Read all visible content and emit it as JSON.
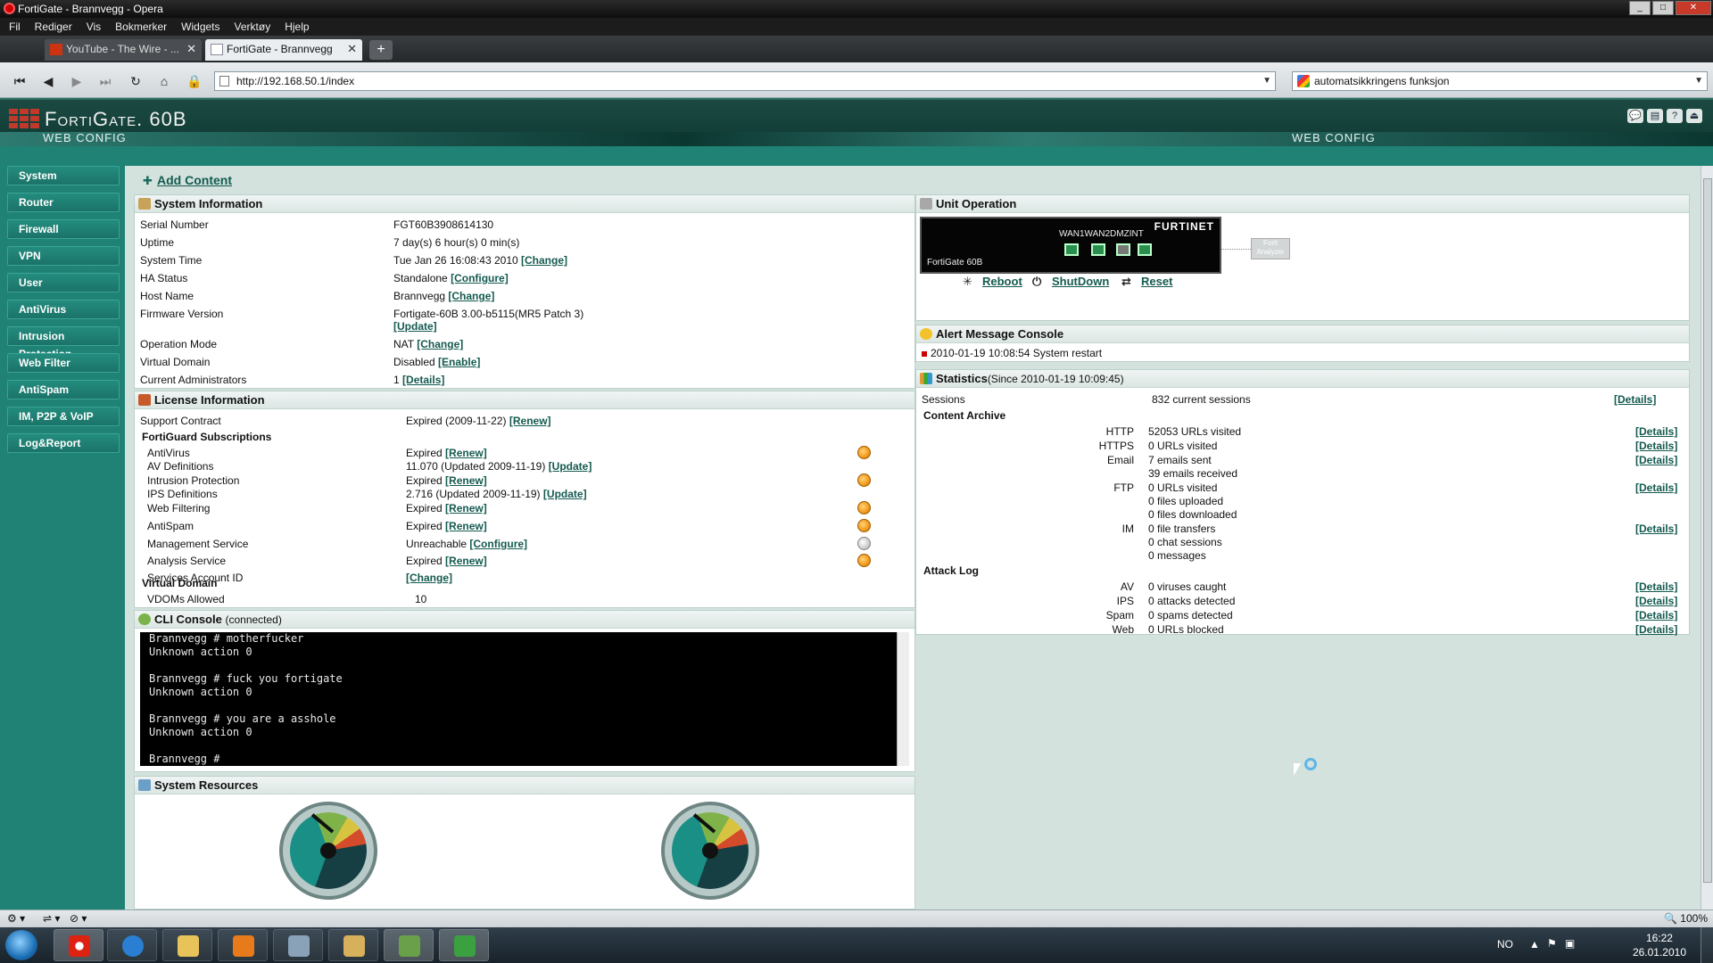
{
  "window": {
    "title": "FortiGate - Brannvegg - Opera"
  },
  "menu": [
    "Fil",
    "Rediger",
    "Vis",
    "Bokmerker",
    "Widgets",
    "Verktøy",
    "Hjelp"
  ],
  "tabs": [
    {
      "label": "YouTube - The Wire - ..."
    },
    {
      "label": "FortiGate - Brannvegg"
    }
  ],
  "nav": {
    "address": "http://192.168.50.1/index",
    "search": "automatsikkringens funksjon"
  },
  "fortigate": {
    "product": "FortiGate",
    "model": "60B",
    "webconfig": "WEB CONFIG"
  },
  "sidebar": [
    "System",
    "Router",
    "Firewall",
    "VPN",
    "User",
    "AntiVirus",
    "Intrusion Protection",
    "Web Filter",
    "AntiSpam",
    "IM, P2P & VoIP",
    "Log&Report"
  ],
  "add_content": "Add Content",
  "sysinfo": {
    "title": "System Information",
    "rows": [
      {
        "label": "Serial Number",
        "value": "FGT60B3908614130",
        "link": ""
      },
      {
        "label": "Uptime",
        "value": "7 day(s) 6 hour(s) 0 min(s)",
        "link": ""
      },
      {
        "label": "System Time",
        "value": "Tue Jan 26 16:08:43 2010",
        "link": "[Change]"
      },
      {
        "label": "HA Status",
        "value": "Standalone",
        "link": "[Configure]"
      },
      {
        "label": "Host Name",
        "value": "Brannvegg",
        "link": "[Change]"
      },
      {
        "label": "Firmware Version",
        "value": "Fortigate-60B 3.00-b5115(MR5 Patch 3)",
        "link": "[Update]"
      },
      {
        "label": "Operation Mode",
        "value": "NAT",
        "link": "[Change]"
      },
      {
        "label": "Virtual Domain",
        "value": "Disabled",
        "link": "[Enable]"
      },
      {
        "label": "Current Administrators",
        "value": "1",
        "link": "[Details]"
      }
    ]
  },
  "license": {
    "title": "License Information",
    "support": {
      "label": "Support Contract",
      "value": "Expired (2009-11-22)",
      "link": "[Renew]"
    },
    "fortiguard_heading": "FortiGuard Subscriptions",
    "rows": [
      {
        "label": "AntiVirus",
        "value": "Expired",
        "link": "[Renew]",
        "status": "warn"
      },
      {
        "label": "AV Definitions",
        "value": "11.070 (Updated 2009-11-19)",
        "link": "[Update]",
        "status": ""
      },
      {
        "label": "Intrusion Protection",
        "value": "Expired",
        "link": "[Renew]",
        "status": "warn"
      },
      {
        "label": "IPS Definitions",
        "value": "2.716 (Updated 2009-11-19)",
        "link": "[Update]",
        "status": ""
      },
      {
        "label": "Web Filtering",
        "value": "Expired",
        "link": "[Renew]",
        "status": "warn"
      },
      {
        "label": "AntiSpam",
        "value": "Expired",
        "link": "[Renew]",
        "status": "warn"
      },
      {
        "label": "Management Service",
        "value": "Unreachable",
        "link": "[Configure]",
        "status": "grey"
      },
      {
        "label": "Analysis Service",
        "value": "Expired",
        "link": "[Renew]",
        "status": "warn"
      },
      {
        "label": "Services Account ID",
        "value": "",
        "link": "[Change]",
        "status": ""
      }
    ],
    "vdom_heading": "Virtual Domain",
    "vdom": {
      "label": "VDOMs Allowed",
      "value": "10"
    }
  },
  "cli": {
    "title": "CLI Console",
    "state": "(connected)",
    "text": "Brannvegg # motherfucker\nUnknown action 0\n\nBrannvegg # fuck you fortigate\nUnknown action 0\n\nBrannvegg # you are a asshole\nUnknown action 0\n\nBrannvegg #"
  },
  "resources": {
    "title": "System Resources"
  },
  "unit": {
    "title": "Unit Operation",
    "brand": "FURTINET",
    "ports": "WAN1WAN2DMZINT",
    "model": "FortiGate 60B",
    "analyzer": "Forti Analyzer",
    "reboot": "Reboot",
    "shutdown": "ShutDown",
    "reset": "Reset"
  },
  "alert": {
    "title": "Alert Message Console",
    "message": "2010-01-19 10:08:54 System restart"
  },
  "stats": {
    "title": "Statistics",
    "since": "(Since 2010-01-19 10:09:45)",
    "sessions_label": "Sessions",
    "sessions_value": "832 current sessions",
    "details": "[Details]",
    "content_heading": "Content Archive",
    "content": [
      {
        "label": "HTTP",
        "lines": [
          "52053 URLs visited"
        ]
      },
      {
        "label": "HTTPS",
        "lines": [
          "0 URLs visited"
        ]
      },
      {
        "label": "Email",
        "lines": [
          "7 emails sent",
          "39 emails received"
        ]
      },
      {
        "label": "FTP",
        "lines": [
          "0 URLs visited",
          "0 files uploaded",
          "0 files downloaded"
        ]
      },
      {
        "label": "IM",
        "lines": [
          "0 file transfers",
          "0 chat sessions",
          "0 messages"
        ]
      }
    ],
    "attack_heading": "Attack Log",
    "attack": [
      {
        "label": "AV",
        "value": "0 viruses caught"
      },
      {
        "label": "IPS",
        "value": "0 attacks detected"
      },
      {
        "label": "Spam",
        "value": "0 spams detected"
      },
      {
        "label": "Web",
        "value": "0 URLs blocked"
      }
    ]
  },
  "statusbar": {
    "zoom": "100%"
  },
  "taskbar": {
    "lang": "NO",
    "time": "16:22",
    "date": "26.01.2010"
  }
}
